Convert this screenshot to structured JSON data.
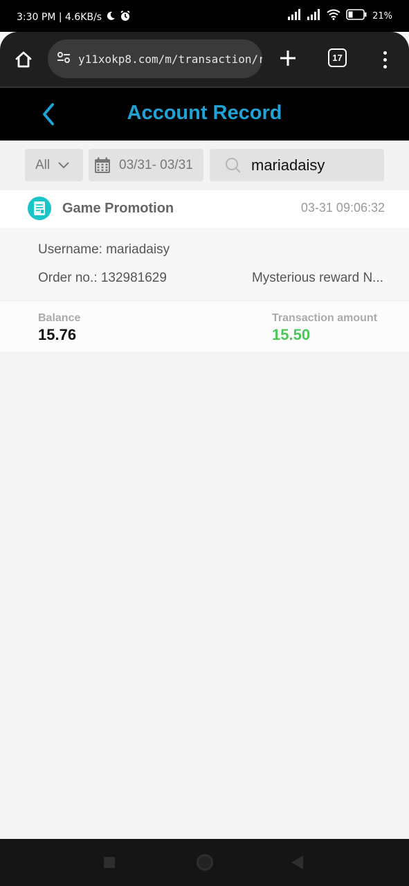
{
  "status_bar": {
    "time_speed": "3:30 PM | 4.6KB/s",
    "battery_percent": "21%"
  },
  "browser": {
    "url": "y11xokp8.com/m/transaction/r",
    "tab_count": "17"
  },
  "header": {
    "title": "Account Record"
  },
  "filters": {
    "type_selected": "All",
    "date_range": "03/31- 03/31",
    "search_value": "mariadaisy"
  },
  "record": {
    "type": "Game Promotion",
    "timestamp": "03-31 09:06:32",
    "username": "Username: mariadaisy",
    "order": "Order no.: 132981629",
    "remark": "Mysterious reward N...",
    "balance_label": "Balance",
    "balance_value": "15.76",
    "amount_label": "Transaction amount",
    "amount_value": "15.50"
  },
  "colors": {
    "accent": "#1fa3d6",
    "amount_positive": "#4cc85a",
    "record_icon": "#19c5c8"
  }
}
